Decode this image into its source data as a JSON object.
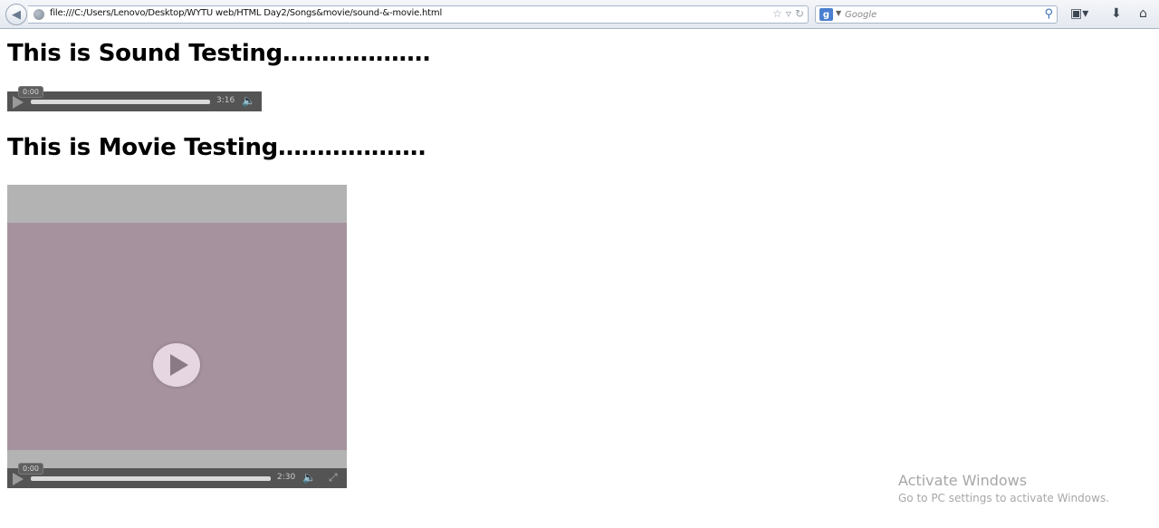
{
  "browser": {
    "url": "file:///C:/Users/Lenovo/Desktop/WYTU web/HTML Day2/Songs&movie/sound-&-movie.html",
    "search_placeholder": "Google",
    "search_engine_letter": "g",
    "icons": [
      "back-icon",
      "globe-icon",
      "star-icon",
      "dropdown-icon",
      "reload-icon",
      "search-icon",
      "bookmarks-icon",
      "download-icon",
      "home-icon"
    ]
  },
  "page": {
    "sound_heading": "This is Sound Testing……………….",
    "movie_heading": "This is Movie Testing……………….",
    "audio": {
      "current_time": "0:00",
      "duration": "3:16"
    },
    "video": {
      "current_time": "0:00",
      "duration": "2:30"
    }
  },
  "watermark": {
    "title": "Activate Windows",
    "subtitle": "Go to PC settings to activate Windows."
  }
}
